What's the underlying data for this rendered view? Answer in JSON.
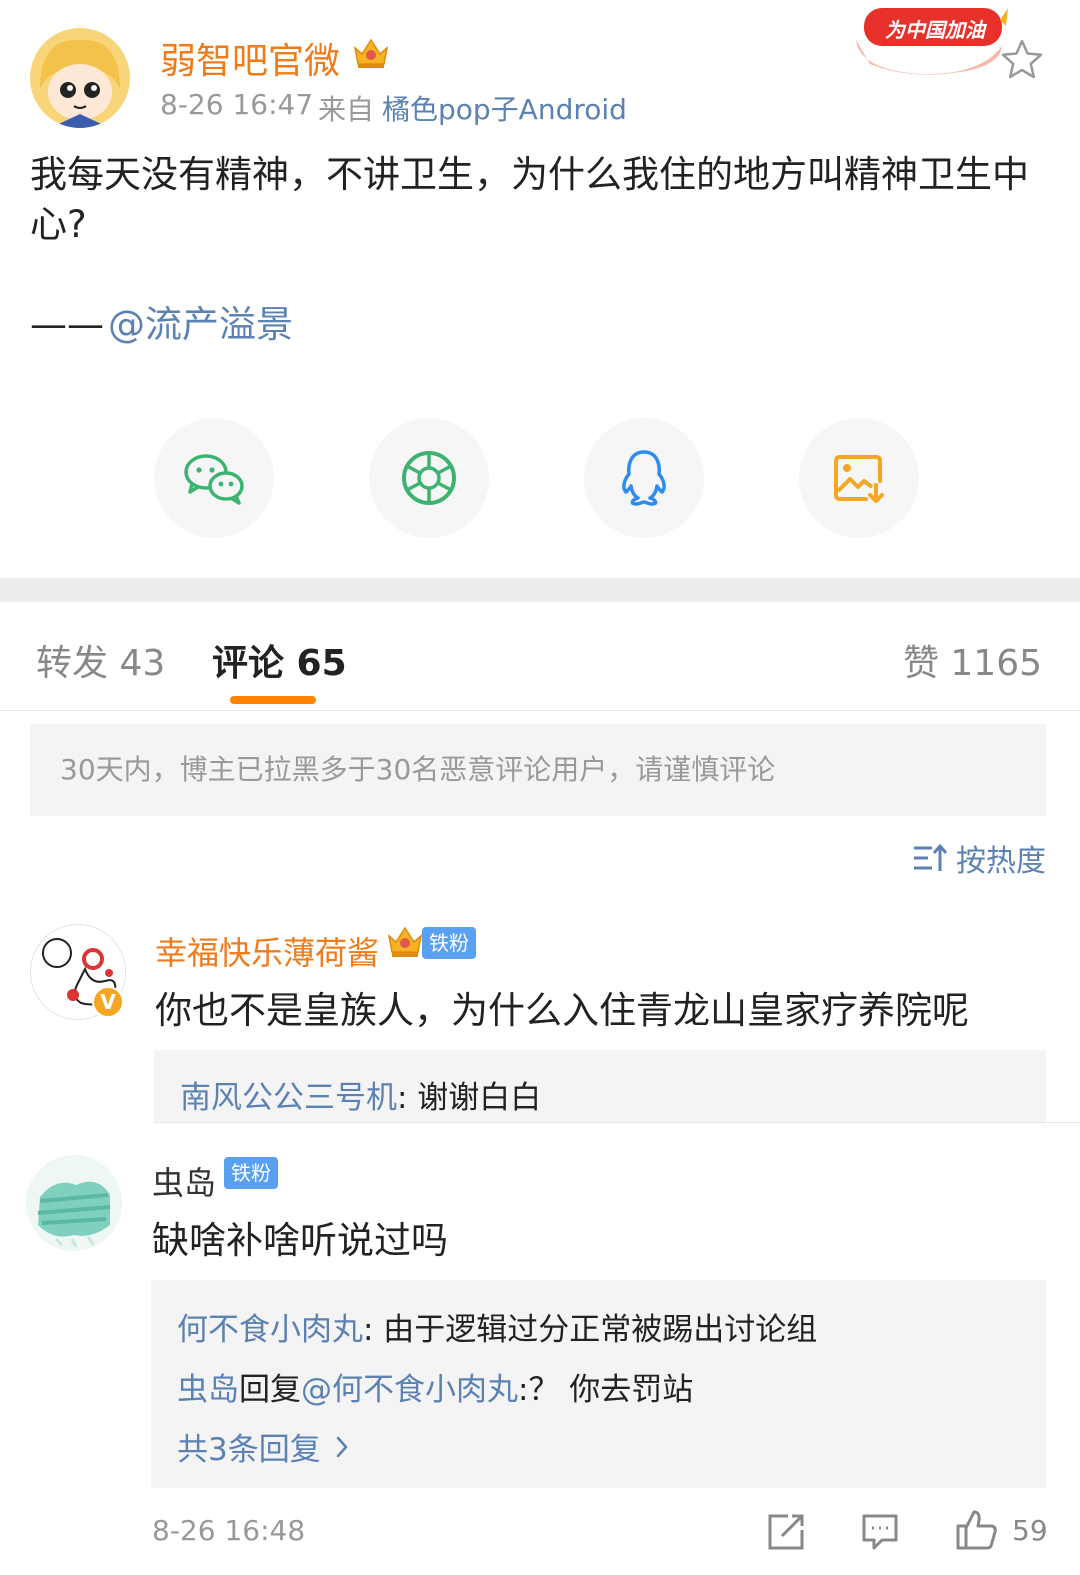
{
  "post": {
    "author": "弱智吧官微",
    "time": "8-26 16:47",
    "source_label": "来自",
    "source_app": "橘色pop子Android",
    "promo_badge": "为中国加油",
    "text": "我每天没有精神，不讲卫生，为什么我住的地方叫精神卫生中心?",
    "signature_dash": "——",
    "signature_mention": "@流产溢景"
  },
  "share": [
    {
      "icon": "wechat-icon",
      "color": "#3cb371"
    },
    {
      "icon": "moments-icon",
      "color": "#3cb371"
    },
    {
      "icon": "qq-icon",
      "color": "#2c8cf0"
    },
    {
      "icon": "save-image-icon",
      "color": "#f5a623"
    }
  ],
  "tabs": {
    "repost": "转发 43",
    "comments": "评论 65",
    "likes": "赞 1165"
  },
  "notice": "30天内，博主已拉黑多于30名恶意评论用户，请谨慎评论",
  "sort_label": "按热度",
  "comments": [
    {
      "author": "幸福快乐薄荷酱",
      "badge": "铁粉",
      "text": "你也不是皇族人，为什么入住青龙山皇家疗养院呢",
      "replies": [
        {
          "author": "南风公公三号机",
          "text": ": 谢谢白白"
        }
      ]
    },
    {
      "author": "虫岛",
      "badge": "铁粉",
      "text": "缺啥补啥听说过吗",
      "replies": [
        {
          "author": "何不食小肉丸",
          "text": ": 由于逻辑过分正常被踢出讨论组"
        },
        {
          "author": "虫岛",
          "mid": "回复",
          "mention": "@何不食小肉丸",
          "text": ":？ 你去罚站"
        }
      ],
      "more_replies": "共3条回复",
      "time": "8-26 16:48",
      "likes": "59"
    }
  ],
  "colors": {
    "accent_orange": "#ff8200",
    "name_orange": "#f07b1a",
    "link_blue": "#5b82b3",
    "badge_blue": "#5aa0f0"
  }
}
